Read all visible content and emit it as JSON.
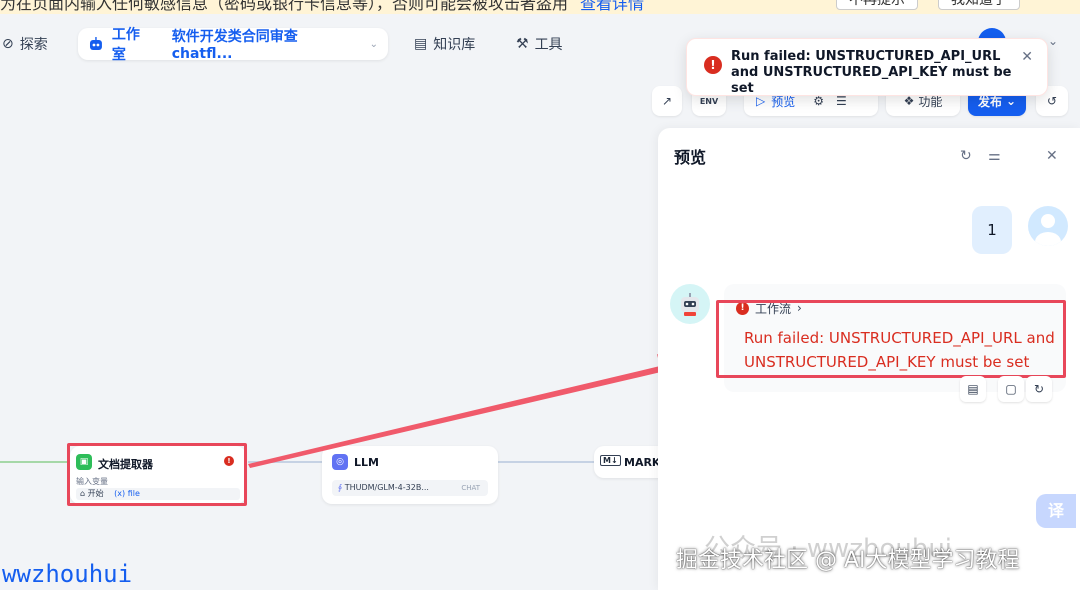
{
  "banner": {
    "text": "为在页面内输入任何敏感信息（密码或银行卡信息等），否则可能会被攻击者盗用",
    "link": "查看详情",
    "btn_no_remind": "不再提示",
    "btn_known": "我知道了"
  },
  "nav": {
    "explore": "探索",
    "studio": "工作室",
    "app_name": "软件开发类合同审查chatfl...",
    "knowledge": "知识库",
    "tools": "工具"
  },
  "toast": {
    "message": "Run failed: UNSTRUCTURED_API_URL and UNSTRUCTURED_API_KEY must be set"
  },
  "toolbar": {
    "env": "ENV",
    "preview": "预览",
    "features": "功能",
    "publish": "发布"
  },
  "nodes": {
    "doc_extractor": {
      "title": "文档提取器",
      "input_label": "输入变量",
      "source_node": "开始",
      "variable": "(x) file"
    },
    "llm": {
      "title": "LLM",
      "model": "THUDM/GLM-4-32B...",
      "mode": "CHAT"
    },
    "markdown": {
      "badge": "M↓",
      "title": "MARKD"
    }
  },
  "preview_panel": {
    "title": "预览",
    "user_message": "1",
    "workflow_tag": "工作流",
    "error": "Run failed: UNSTRUCTURED_API_URL and UNSTRUCTURED_API_KEY must be set"
  },
  "translate_btn": "译",
  "watermarks": {
    "wechat": "公众号 · wwzhouhui",
    "juejin": "掘金技术社区 @ AI大模型学习教程",
    "author": "wwzhouhui"
  },
  "colors": {
    "accent": "#155eef",
    "error": "#d92d20",
    "highlight": "#e8475a"
  }
}
